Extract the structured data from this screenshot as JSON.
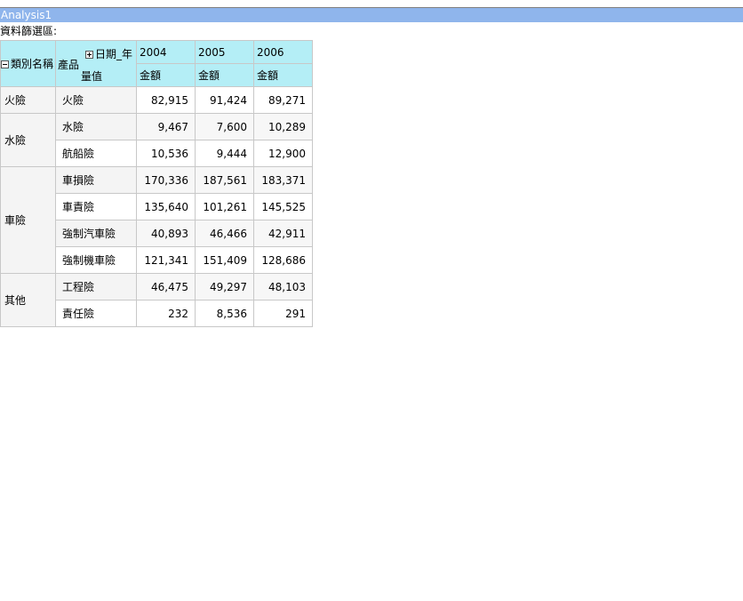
{
  "window": {
    "title": "Analysis1"
  },
  "filter_area": {
    "label": "資料篩選區:"
  },
  "pivot": {
    "row_field_1": "類別名稱",
    "row_field_2": "產品",
    "column_field": "日期_年",
    "measure_header": "量值",
    "years": [
      "2004",
      "2005",
      "2006"
    ],
    "measure_name": "金額",
    "groups": [
      {
        "category": "火險",
        "rows": [
          {
            "product": "火險",
            "values": [
              "82,915",
              "91,424",
              "89,271"
            ]
          }
        ]
      },
      {
        "category": "水險",
        "rows": [
          {
            "product": "水險",
            "values": [
              "9,467",
              "7,600",
              "10,289"
            ]
          },
          {
            "product": "航船險",
            "values": [
              "10,536",
              "9,444",
              "12,900"
            ]
          }
        ]
      },
      {
        "category": "車險",
        "rows": [
          {
            "product": "車損險",
            "values": [
              "170,336",
              "187,561",
              "183,371"
            ]
          },
          {
            "product": "車責險",
            "values": [
              "135,640",
              "101,261",
              "145,525"
            ]
          },
          {
            "product": "強制汽車險",
            "values": [
              "40,893",
              "46,466",
              "42,911"
            ]
          },
          {
            "product": "強制機車險",
            "values": [
              "121,341",
              "151,409",
              "128,686"
            ]
          }
        ]
      },
      {
        "category": "其他",
        "rows": [
          {
            "product": "工程險",
            "values": [
              "46,475",
              "49,297",
              "48,103"
            ]
          },
          {
            "product": "責任險",
            "values": [
              "232",
              "8,536",
              "291"
            ]
          }
        ]
      }
    ]
  },
  "colors": {
    "title_bar": "#8fb5ec",
    "header_bg": "#b4eef6",
    "row_header_bg": "#f4f4f4",
    "border": "#c8c8c8"
  }
}
